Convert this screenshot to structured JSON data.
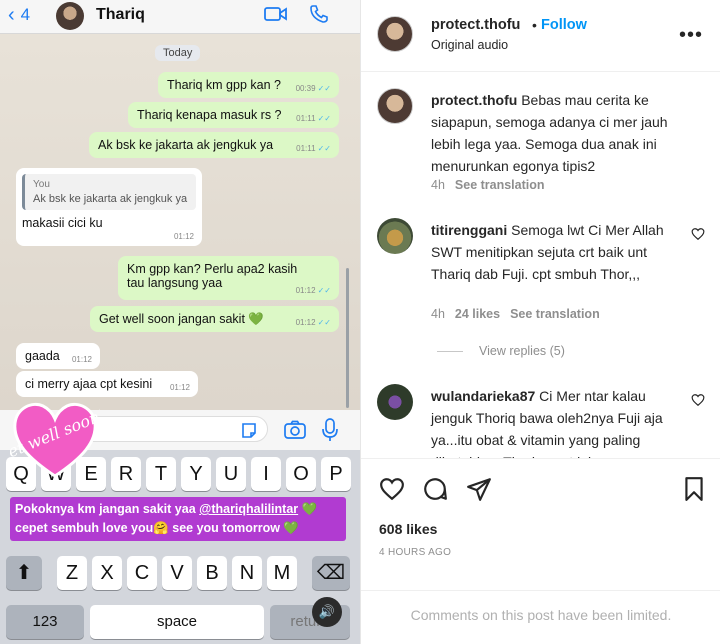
{
  "chat": {
    "back_count": "4",
    "contact_name": "Thariq",
    "day": "Today",
    "messages": [
      {
        "text": "Thariq km gpp kan ?",
        "time": "00:39"
      },
      {
        "text": "Thariq kenapa masuk rs ?",
        "time": "01:11"
      },
      {
        "text": "Ak bsk ke jakarta ak jengkuk ya",
        "time": "01:11"
      },
      {
        "quote_author": "You",
        "quote_text": "Ak bsk ke jakarta ak jengkuk ya",
        "text": "makasii cici ku",
        "time": "01:12"
      },
      {
        "text": "Km gpp kan? Perlu apa2 kasih tau langsung yaa",
        "time": "01:12"
      },
      {
        "text": "Get well soon jangan sakit 💚",
        "time": "01:12"
      },
      {
        "text": "gaada",
        "time": "01:12"
      },
      {
        "text": "ci merry ajaa cpt kesini",
        "time": "01:12"
      }
    ]
  },
  "keyboard": {
    "row1": [
      "Q",
      "W",
      "E",
      "R",
      "T",
      "Y",
      "U",
      "I",
      "O",
      "P"
    ],
    "row3": [
      "Z",
      "X",
      "C",
      "V",
      "B",
      "N",
      "M"
    ],
    "numbers_label": "123",
    "space_label": "space",
    "return_label": "return"
  },
  "story": {
    "sticker_text": "get well soon!",
    "caption_pre": "Pokoknya km jangan sakit yaa ",
    "caption_mention": "@thariqhalilintar",
    "caption_post": " 💚 cepet sembuh love you🤗 see you tomorrow 💚"
  },
  "post": {
    "username": "protect.thofu",
    "follow_label": "Follow",
    "audio": "Original audio",
    "caption": {
      "username": "protect.thofu",
      "text": "Bebas mau cerita ke siapapun, semoga adanya ci mer jauh lebih lega yaa. Semoga dua anak ini menurunkan egonya tipis2",
      "time": "4h",
      "translate": "See translation"
    },
    "comments": [
      {
        "username": "titirenggani",
        "text": "Semoga lwt Ci Mer Allah SWT menitipkan sejuta crt baik unt Thariq dab Fuji. cpt smbuh Thor,,,",
        "time": "4h",
        "likes": "24 likes",
        "translate": "See translation"
      },
      {
        "username": "wulandarieka87",
        "text": "Ci Mer ntar kalau jenguk Thoriq bawa oleh2nya Fuji aja ya...itu obat & vitamin yang paling dibutuhkan Thoriq saat ini"
      }
    ],
    "view_replies": "View replies (5)",
    "likes": "608 likes",
    "time_ago": "4 HOURS AGO",
    "limited_notice": "Comments on this post have been limited."
  }
}
